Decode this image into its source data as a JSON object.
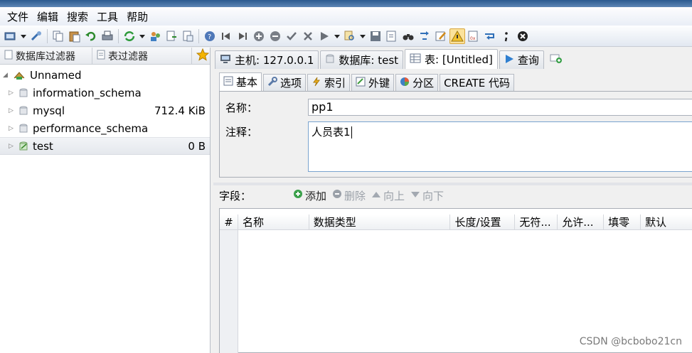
{
  "menu": [
    "文件",
    "编辑",
    "搜索",
    "工具",
    "帮助"
  ],
  "left": {
    "filters": {
      "db_filter": "数据库过滤器",
      "table_filter": "表过滤器"
    },
    "tree": {
      "root": "Unnamed",
      "databases": [
        {
          "name": "information_schema",
          "size": ""
        },
        {
          "name": "mysql",
          "size": "712.4 KiB"
        },
        {
          "name": "performance_schema",
          "size": ""
        },
        {
          "name": "test",
          "size": "0 B",
          "selected": true
        }
      ]
    }
  },
  "tabs": {
    "host": "主机: 127.0.0.1",
    "database": "数据库: test",
    "table": "表: [Untitled]",
    "query": "查询"
  },
  "subtabs": {
    "basic": "基本",
    "options": "选项",
    "indexes": "索引",
    "foreign_keys": "外键",
    "partitions": "分区",
    "create_code": "CREATE 代码"
  },
  "form": {
    "name_label": "名称：",
    "name_value": "pp1",
    "comment_label": "注释：",
    "comment_value": "人员表1"
  },
  "fields": {
    "label": "字段：",
    "add": "添加",
    "delete": "删除",
    "up": "向上",
    "down": "向下"
  },
  "grid": {
    "columns": [
      "#",
      "名称",
      "数据类型",
      "长度/设置",
      "无符...",
      "允许...",
      "填零",
      "默认"
    ]
  },
  "watermark": "CSDN @bcbobo21cn"
}
